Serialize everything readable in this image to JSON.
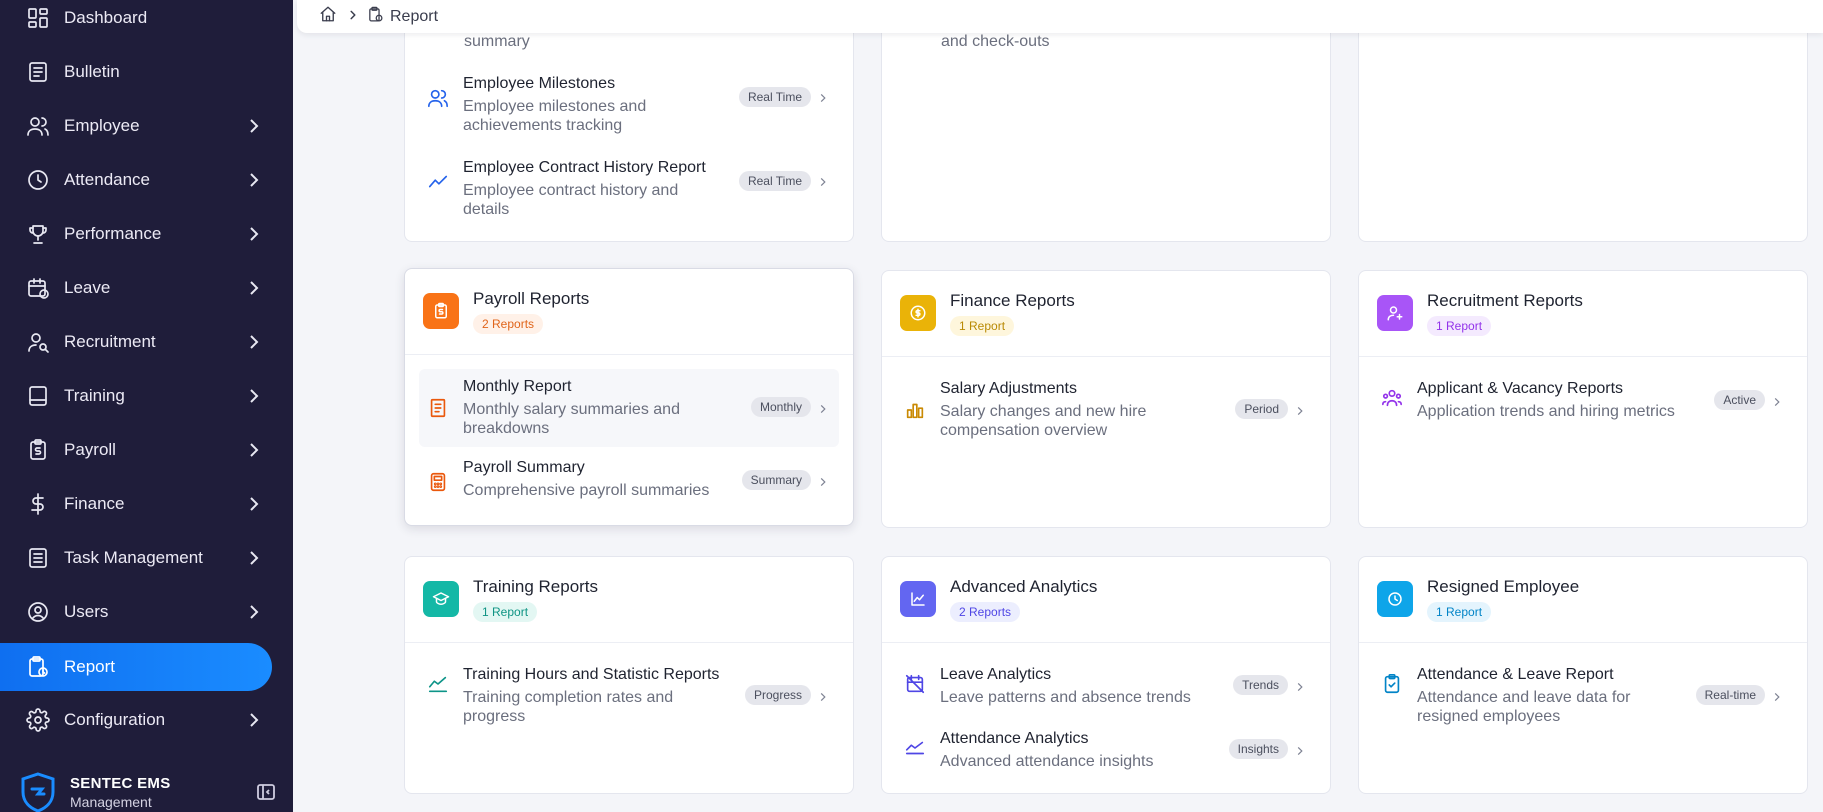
{
  "sidebar": {
    "items": [
      {
        "label": "Dashboard",
        "icon": "dashboard-icon",
        "has_submenu": false
      },
      {
        "label": "Bulletin",
        "icon": "bulletin-icon",
        "has_submenu": false
      },
      {
        "label": "Employee",
        "icon": "users-icon",
        "has_submenu": true
      },
      {
        "label": "Attendance",
        "icon": "clock-icon",
        "has_submenu": true
      },
      {
        "label": "Performance",
        "icon": "trophy-icon",
        "has_submenu": true
      },
      {
        "label": "Leave",
        "icon": "calendar-icon",
        "has_submenu": true
      },
      {
        "label": "Recruitment",
        "icon": "user-search-icon",
        "has_submenu": true
      },
      {
        "label": "Training",
        "icon": "book-icon",
        "has_submenu": true
      },
      {
        "label": "Payroll",
        "icon": "payroll-icon",
        "has_submenu": true
      },
      {
        "label": "Finance",
        "icon": "dollar-icon",
        "has_submenu": true
      },
      {
        "label": "Task Management",
        "icon": "task-icon",
        "has_submenu": true
      },
      {
        "label": "Users",
        "icon": "user-circle-icon",
        "has_submenu": true
      },
      {
        "label": "Report",
        "icon": "report-icon",
        "has_submenu": false,
        "active": true
      },
      {
        "label": "Configuration",
        "icon": "gear-icon",
        "has_submenu": true
      }
    ],
    "brand": {
      "name": "SENTEC EMS",
      "subtitle": "Management"
    }
  },
  "breadcrumb": {
    "home_icon": "home-icon",
    "separator": ">",
    "current": "Report"
  },
  "colors": {
    "sidebar_bg": "#1f1d3a",
    "active_nav": "#1a7ff5",
    "payroll": "#f97316",
    "finance": "#eab308",
    "recruitment": "#a855f7",
    "training": "#14b8a6",
    "analytics": "#6366f1",
    "resigned": "#0ea5e9"
  },
  "partial_cards": {
    "col1_row1": {
      "partial_desc": "summary"
    },
    "col2_row1": {
      "partial_desc": "and check-outs"
    }
  },
  "cards": {
    "employee_partial": {
      "rows": [
        {
          "title": "Employee Milestones",
          "desc": "Employee milestones and achievements tracking",
          "badge": "Real Time"
        },
        {
          "title": "Employee Contract History Report",
          "desc": "Employee contract history and details",
          "badge": "Real Time"
        }
      ]
    },
    "payroll": {
      "title": "Payroll Reports",
      "count": "2 Reports",
      "rows": [
        {
          "title": "Monthly Report",
          "desc": "Monthly salary summaries and breakdowns",
          "badge": "Monthly"
        },
        {
          "title": "Payroll Summary",
          "desc": "Comprehensive payroll summaries",
          "badge": "Summary"
        }
      ]
    },
    "finance": {
      "title": "Finance Reports",
      "count": "1 Report",
      "rows": [
        {
          "title": "Salary Adjustments",
          "desc": "Salary changes and new hire compensation overview",
          "badge": "Period"
        }
      ]
    },
    "recruitment": {
      "title": "Recruitment Reports",
      "count": "1 Report",
      "rows": [
        {
          "title": "Applicant & Vacancy Reports",
          "desc": "Application trends and hiring metrics",
          "badge": "Active"
        }
      ]
    },
    "training": {
      "title": "Training Reports",
      "count": "1 Report",
      "rows": [
        {
          "title": "Training Hours and Statistic Reports",
          "desc": "Training completion rates and progress",
          "badge": "Progress"
        }
      ]
    },
    "analytics": {
      "title": "Advanced Analytics",
      "count": "2 Reports",
      "rows": [
        {
          "title": "Leave Analytics",
          "desc": "Leave patterns and absence trends",
          "badge": "Trends"
        },
        {
          "title": "Attendance Analytics",
          "desc": "Advanced attendance insights",
          "badge": "Insights"
        }
      ]
    },
    "resigned": {
      "title": "Resigned Employee",
      "count": "1 Report",
      "rows": [
        {
          "title": "Attendance & Leave Report",
          "desc": "Attendance and leave data for resigned employees",
          "badge": "Real-time"
        }
      ]
    }
  }
}
